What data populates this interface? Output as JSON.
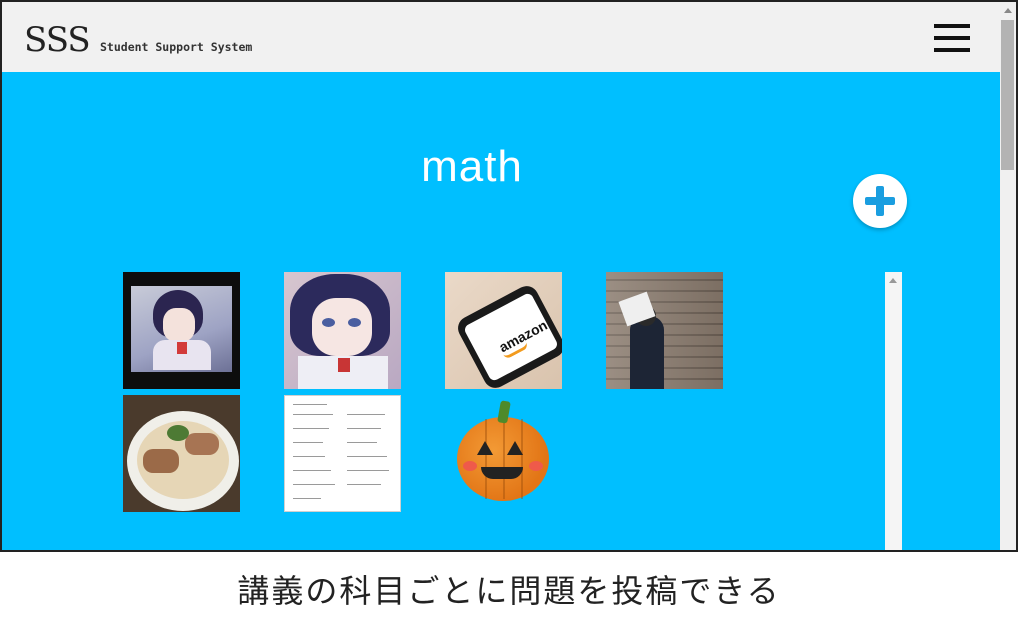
{
  "header": {
    "logo": "SSS",
    "logo_subtitle": "Student Support System",
    "menu_icon": "hamburger-menu-icon"
  },
  "main": {
    "title": "math",
    "add_icon": "plus-circle-icon",
    "thumbnails": [
      {
        "name": "thumbnail-anime-girl-framed",
        "icon": "image-icon"
      },
      {
        "name": "thumbnail-anime-girl",
        "icon": "image-icon"
      },
      {
        "name": "thumbnail-amazon-phone",
        "icon": "image-icon",
        "brand_text": "amazon"
      },
      {
        "name": "thumbnail-brick-wall-person",
        "icon": "image-icon"
      },
      {
        "name": "thumbnail-ramen",
        "icon": "image-icon"
      },
      {
        "name": "thumbnail-math-sheet",
        "icon": "image-icon"
      },
      {
        "name": "thumbnail-pumpkin",
        "icon": "image-icon"
      }
    ]
  },
  "caption": "講義の科目ごとに問題を投稿できる",
  "colors": {
    "background": "#00bfff",
    "header": "#f1f1f1",
    "accent": "#1a9ee0",
    "text_light": "#ffffff"
  }
}
